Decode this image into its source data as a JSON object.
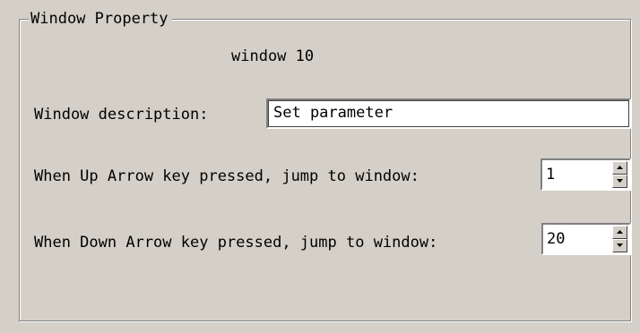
{
  "window_property": {
    "legend": "Window Property",
    "window_name": "window 10",
    "description": {
      "label": "Window description:",
      "value": "Set parameter"
    },
    "up_arrow": {
      "label": "When Up Arrow key pressed, jump to window:",
      "value": "1"
    },
    "down_arrow": {
      "label": "When Down Arrow key pressed, jump to window:",
      "value": "20"
    }
  },
  "colors": {
    "dialog_background": "#d4d0c8",
    "field_background": "#ffffff",
    "shadow": "#808080",
    "highlight": "#ffffff"
  },
  "icons": [
    "spin-up-arrow-icon",
    "spin-down-arrow-icon"
  ]
}
